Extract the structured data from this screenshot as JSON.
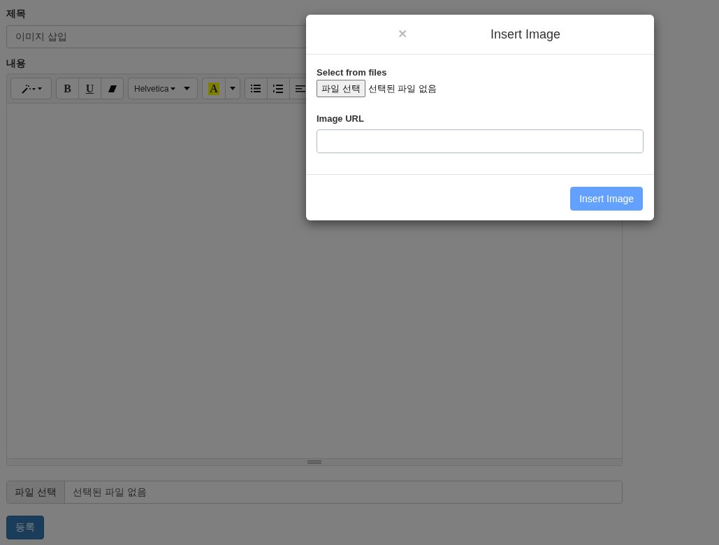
{
  "form": {
    "title_label": "제목",
    "title_value": "이미지 삽입",
    "content_label": "내용",
    "toolbar": [
      [
        {
          "kind": "magic"
        }
      ],
      [
        {
          "kind": "bold",
          "label": "B"
        },
        {
          "kind": "underline",
          "label": "U"
        },
        {
          "kind": "eraser"
        }
      ],
      [
        {
          "kind": "font",
          "label": "Helvetica"
        }
      ],
      [
        {
          "kind": "color",
          "label": "A"
        },
        {
          "kind": "caret"
        }
      ],
      [
        {
          "kind": "ul"
        },
        {
          "kind": "ol"
        },
        {
          "kind": "align"
        }
      ]
    ],
    "file_button": "파일 선택",
    "file_status": "선택된 파일 없음",
    "submit": "등록"
  },
  "modal": {
    "close": "×",
    "title": "Insert Image",
    "files_label": "Select from files",
    "file_button": "파일 선택",
    "file_status": "선택된 파일 없음",
    "url_label": "Image URL",
    "insert_button": "Insert Image",
    "insert_disabled": true
  }
}
